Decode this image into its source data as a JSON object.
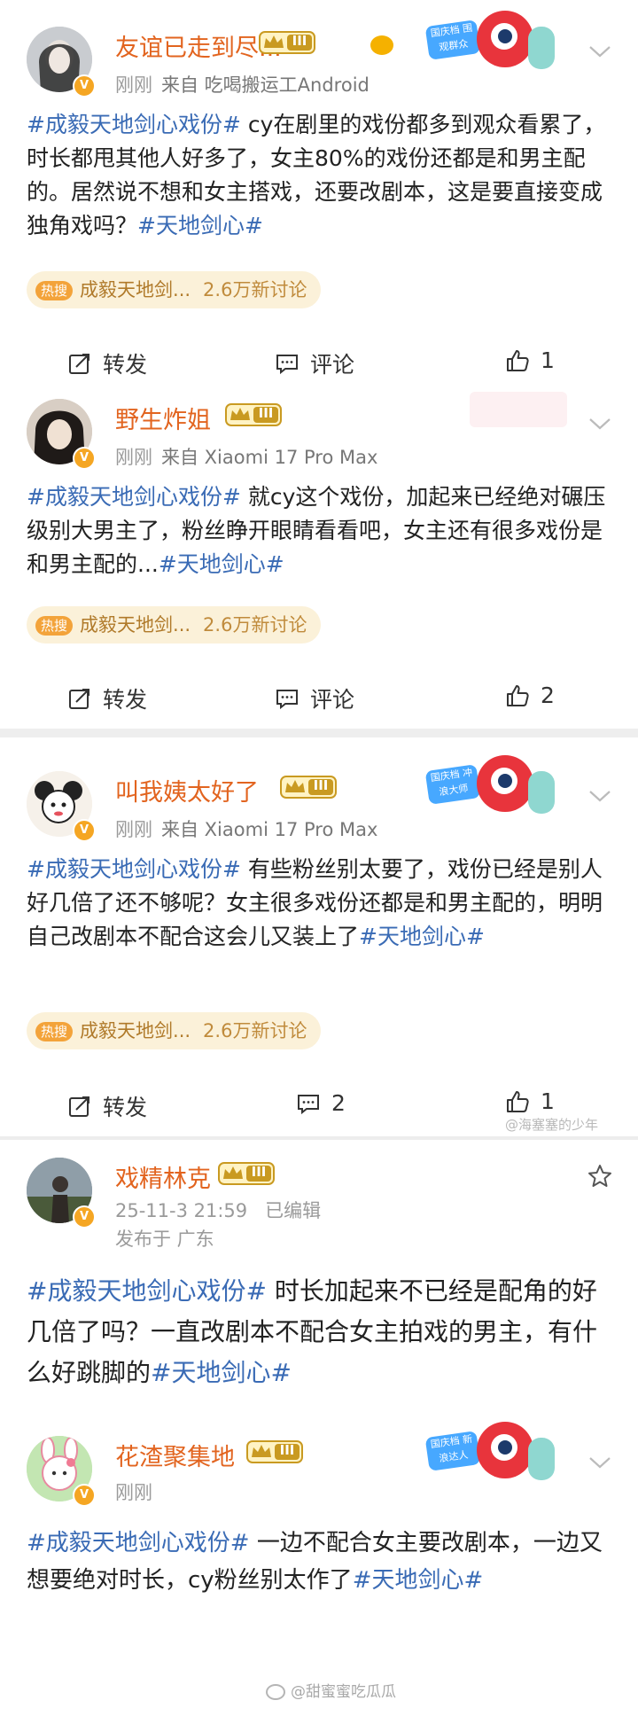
{
  "posts": [
    {
      "username": "友谊已走到尽...",
      "level": "III",
      "time": "刚刚",
      "source": "来自 吃喝搬运工Android",
      "hashtag_lead": "#成毅天地剑心戏份#",
      "text": " cy在剧里的戏份都多到观众看累了，时长都甩其他人好多了，女主80%的戏份还都是和男主配的。居然说不想和女主搭戏，还要改剧本，这是要直接变成独角戏吗？",
      "hashtag_tail": "#天地剑心#",
      "topic_tag": "热搜",
      "topic": "成毅天地剑...",
      "topic_count": "2.6万新讨论",
      "repost_label": "转发",
      "comment_label": "评论",
      "like_count": "1"
    },
    {
      "username": "野生炸姐",
      "level": "III",
      "time": "刚刚",
      "source": "来自 Xiaomi 17 Pro Max",
      "hashtag_lead": "#成毅天地剑心戏份#",
      "text": " 就cy这个戏份，加起来已经绝对碾压级别大男主了，粉丝睁开眼睛看看吧，女主还有很多戏份是和男主配的...",
      "hashtag_tail": "#天地剑心#",
      "topic_tag": "热搜",
      "topic": "成毅天地剑...",
      "topic_count": "2.6万新讨论",
      "repost_label": "转发",
      "comment_label": "评论",
      "like_count": "2"
    },
    {
      "username": "叫我姨太好了",
      "level": "III",
      "time": "刚刚",
      "source": "来自 Xiaomi 17 Pro Max",
      "hashtag_lead": "#成毅天地剑心戏份#",
      "text": " 有些粉丝别太要了，戏份已经是别人好几倍了还不够呢？女主很多戏份还都是和男主配的，明明自己改剧本不配合这会儿又装上了",
      "hashtag_tail": "#天地剑心#",
      "topic_tag": "热搜",
      "topic": "成毅天地剑...",
      "topic_count": "2.6万新讨论",
      "repost_label": "转发",
      "comment_count": "2",
      "like_count": "1",
      "watermark": "@海塞塞的少年"
    },
    {
      "username": "戏精林克",
      "level": "III",
      "time": "25-11-3 21:59",
      "edited": "已编辑",
      "location": "发布于 广东",
      "hashtag_lead": "#成毅天地剑心戏份#",
      "text": " 时长加起来不已经是配角的好几倍了吗？一直改剧本不配合女主拍戏的男主，有什么好跳脚的",
      "hashtag_tail": "#天地剑心#"
    },
    {
      "username": "花渣聚集地",
      "level": "III",
      "time": "刚刚",
      "hashtag_lead": "#成毅天地剑心戏份#",
      "text": " 一边不配合女主要改剧本，一边又想要绝对时长，cy粉丝别太作了",
      "hashtag_tail": "#天地剑心#"
    }
  ],
  "decorations": {
    "badge_1": "国庆档 围观群众",
    "badge_3": "国庆档 冲浪大师",
    "badge_5": "国庆档 新浪达人"
  },
  "footer_watermark": "@甜蜜蜜吃瓜瓜",
  "colors": {
    "username": "#e2641f",
    "hashtag": "#3a6bb5",
    "topic_bg": "#fbf1d9"
  }
}
